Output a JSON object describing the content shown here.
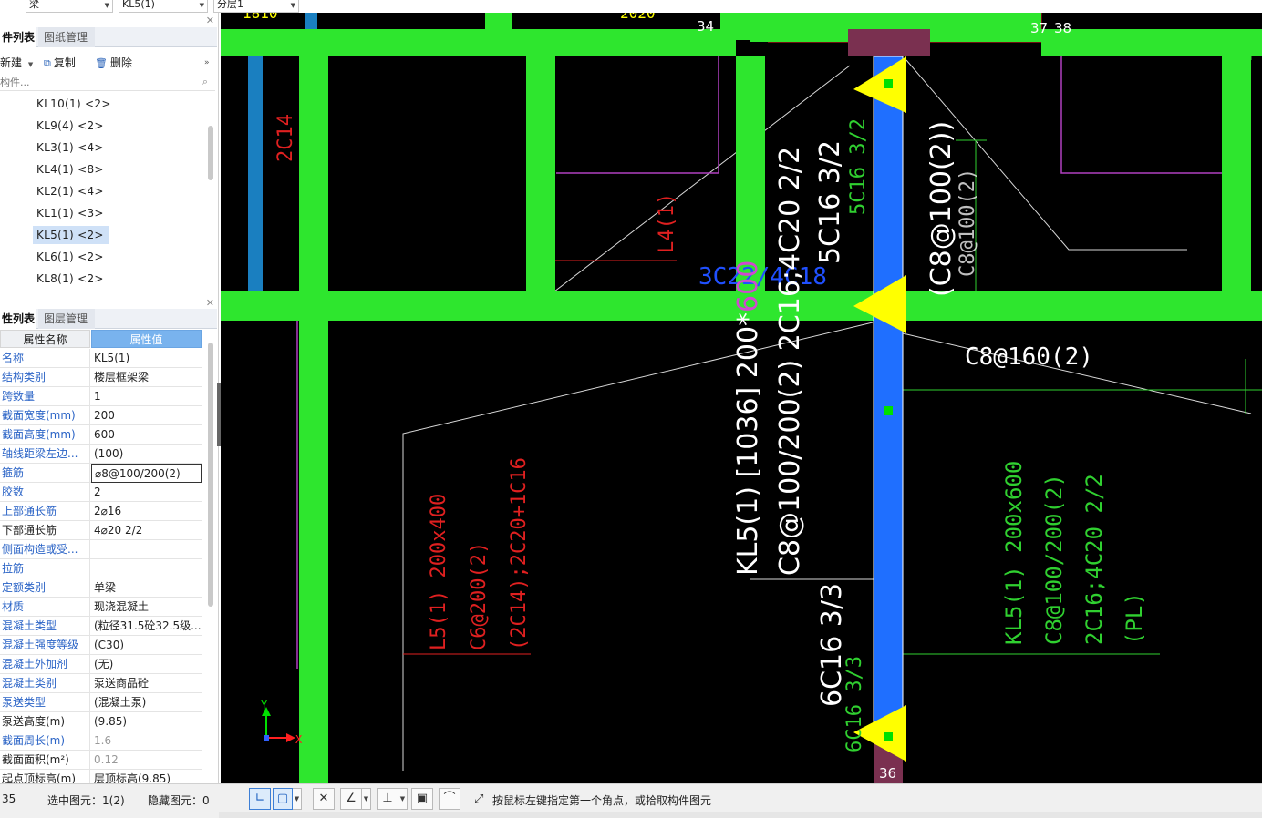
{
  "top_selectors": {
    "element_type": "梁",
    "component": "KL5(1)",
    "layer": "分层1"
  },
  "component_panel": {
    "tabs": [
      "件列表",
      "图纸管理"
    ],
    "toolbar": {
      "new": "新建",
      "copy": "复制",
      "delete": "删除"
    },
    "search_placeholder": "构件...",
    "items": [
      "KL10(1) <2>",
      "KL9(4) <2>",
      "KL3(1) <4>",
      "KL4(1) <8>",
      "KL2(1) <4>",
      "KL1(1) <3>",
      "KL5(1) <2>",
      "KL6(1) <2>",
      "KL8(1) <2>"
    ],
    "selected": "KL5(1) <2>"
  },
  "property_panel": {
    "tabs": [
      "性列表",
      "图层管理"
    ],
    "header_name": "属性名称",
    "header_value": "属性值",
    "rows": [
      {
        "name": "名称",
        "value": "KL5(1)"
      },
      {
        "name": "结构类别",
        "value": "楼层框架梁"
      },
      {
        "name": "跨数量",
        "value": "1"
      },
      {
        "name": "截面宽度(mm)",
        "value": "200"
      },
      {
        "name": "截面高度(mm)",
        "value": "600"
      },
      {
        "name": "轴线距梁左边...",
        "value": "(100)"
      },
      {
        "name": "箍筋",
        "value": "⌀8@100/200(2)"
      },
      {
        "name": "胶数",
        "value": "2"
      },
      {
        "name": "上部通长筋",
        "value": "2⌀16"
      },
      {
        "name": "下部通长筋",
        "value": "4⌀20 2/2"
      },
      {
        "name": "侧面构造或受...",
        "value": ""
      },
      {
        "name": "拉筋",
        "value": ""
      },
      {
        "name": "定额类别",
        "value": "单梁"
      },
      {
        "name": "材质",
        "value": "现浇混凝土"
      },
      {
        "name": "混凝土类型",
        "value": "(粒径31.5砼32.5级..."
      },
      {
        "name": "混凝土强度等级",
        "value": "(C30)"
      },
      {
        "name": "混凝土外加剂",
        "value": "(无)"
      },
      {
        "name": "混凝土类别",
        "value": "泵送商品砼"
      },
      {
        "name": "泵送类型",
        "value": "(混凝土泵)"
      },
      {
        "name": "泵送高度(m)",
        "value": "(9.85)"
      },
      {
        "name": "截面周长(m)",
        "value": "1.6"
      },
      {
        "name": "截面面积(m²)",
        "value": "0.12"
      },
      {
        "name": "起点顶标高(m)",
        "value": "层顶标高(9.85)"
      }
    ]
  },
  "drawing": {
    "grid_labels": [
      "34",
      "37",
      "38",
      "36"
    ],
    "annotations": {
      "kl5_main_1": "KL5(1) [1036] 200*",
      "kl5_main_1b": "600",
      "kl5_main_2": "C8@100/200(2) 2C16;4C20 2/2",
      "top_bar_1": "5C16 3/2",
      "top_bar_2": "5C16 3/2",
      "stirrup_right": "(C8@100(2))",
      "stirrup_right_2": "C8@100(2)",
      "c8_160": "C8@160(2)",
      "blue_text": "3C22/4C18",
      "l4": "L4(1)",
      "c14": "2C14",
      "l5_1": "L5(1) 200x400",
      "l5_2": "C6@200(2)",
      "l5_3": "(2C14);2C20+1C16",
      "bottom_bar_1": "6C16 3/3",
      "bottom_bar_2": "6C16 3/3",
      "green_kl5_1": "KL5(1) 200x600",
      "green_kl5_2": "C8@100/200(2)",
      "green_kl5_3": "2C16;4C20 2/2",
      "green_kl5_4": "(PL)",
      "top_partial": "1810",
      "top_partial_2": "2020"
    },
    "axis": {
      "x": "X",
      "y": "Y"
    },
    "colors": {
      "beam_green": "#2ee62e",
      "beam_blue": "#1f6fff",
      "marker_yellow": "#ffff00",
      "background": "#000000"
    }
  },
  "status_bar": {
    "left_value": "35",
    "selected_label": "选中图元：1(2)",
    "hidden_label": "隐藏图元：0",
    "hint": "按鼠标左键指定第一个角点，或拾取构件图元"
  }
}
